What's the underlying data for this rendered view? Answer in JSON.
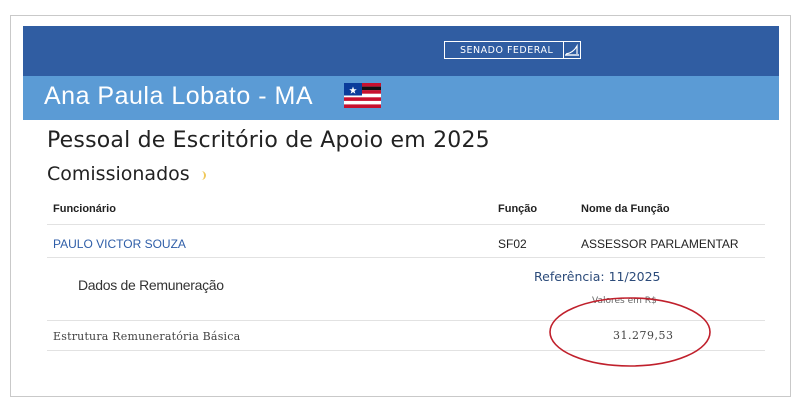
{
  "header": {
    "badge_label": "SENADO FEDERAL",
    "senator_name": "Ana Paula Lobato - MA",
    "flag_icon": "maranhao-flag-icon"
  },
  "colors": {
    "topbar": "#305da2",
    "namebar": "#5b9bd5",
    "link": "#2f5ea8",
    "annotation_circle": "#c0202c"
  },
  "main": {
    "title": "Pessoal de Escritório de Apoio em 2025",
    "subtitle": "Comissionados"
  },
  "table": {
    "columns": [
      "Funcionário",
      "Função",
      "Nome da Função"
    ],
    "rows": [
      [
        "PAULO VICTOR SOUZA",
        "SF02",
        "ASSESSOR PARLAMENTAR"
      ]
    ]
  },
  "remuneracao": {
    "heading": "Dados de Remuneração",
    "referencia": "Referência: 11/2025",
    "currency_note": "Valores em R$",
    "items": [
      {
        "label": "Estrutura Remuneratória Básica",
        "value": "31.279,53"
      }
    ]
  }
}
